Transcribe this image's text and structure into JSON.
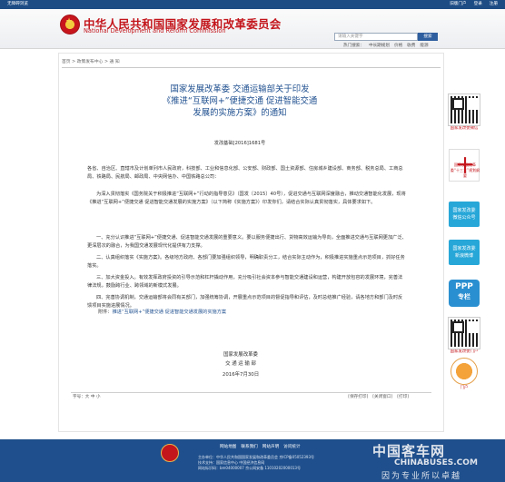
{
  "topbar": {
    "left": "无障碍浏览",
    "links": [
      "旧版门户",
      "登录",
      "注册"
    ]
  },
  "header": {
    "cn_title": "中华人民共和国国家发展和改革委员会",
    "en_title": "National Development and Reform Commission",
    "search_placeholder": "请输入关键字",
    "search_btn": "搜索",
    "quick_links": [
      "热门搜索：",
      "中长期规划",
      "价格",
      "收费",
      "能源"
    ]
  },
  "breadcrumb": "首页 > 政策发布中心 > 通  知",
  "article": {
    "title_lines": [
      "国家发展改革委  交通运输部关于印发",
      "《推进“互联网+”便捷交通  促进智能交通",
      "发展的实施方案》的通知"
    ],
    "doc_no": "发改基础[2016]1681号",
    "paragraphs": [
      "各省、自治区、直辖市及计划单列市人民政府，科技部、工业和信息化部、公安部、财政部、国土资源部、住房城乡建设部、商务部、税务总局、工商总局、铁路局、民航局、邮政局、中央网信办、中国铁路总公司：",
      "为深入贯彻落实《国务院关于积极推进“互联网+”行动的指导意见》（国发〔2015〕40号），促进交通与互联网深度融合，推动交通智能化发展，现将《推进“互联网+”便捷交通 促进智能交通发展的实施方案》（以下简称《实施方案》）印发你们，请结合实际认真贯彻落实，具体要求如下。",
      "一、充分认识推进“互联网+”便捷交通、促进智能交通发展的重要意义。要以服务便捷出行、货物高效运输为导向，全面推进交通与互联网更加广泛、更深层次的融合，为我国交通发展现代化提供有力支撑。",
      "二、认真组织落实《实施方案》。各级地方政府、各部门要加强组织领导，明确职责分工，结合实际主动作为，积极推进实施重点示范项目，抓好任务落实。",
      "三、加大资金投入。有效发挥政府投资的引导示范和杠杆撬动作用，充分吸引社会资本参与智能交通建设和运营，构建开放包容的发展环境，完善法律法规，鼓励跨行业、跨领域的新模式发展。",
      "四、完善协调机制，交通运输部将会同有关部门，加强统筹协调，开展重点示范项目的督促指导和评估，及时总结推广经验，请各地方和部门及时反馈项目实施进展情况。"
    ],
    "attach_prefix": "附件：",
    "attach_link": "推进“互联网+”便捷交通  促进智能交通发展的实施方案",
    "signature": [
      "国家发展改革委",
      "交 通 运 输 部",
      "2016年7月30日"
    ]
  },
  "tools": {
    "font_size": "字号：大 中 小",
    "links": [
      "[保存打印]",
      "[关闭窗口]",
      "[打印]"
    ]
  },
  "sidebar": {
    "qr1_label": "国家发改委微信",
    "img_label": "国家发展改革委“十三五”规划纲要",
    "btn1": [
      "国家发改委",
      "微信公众号"
    ],
    "btn2": [
      "国家发改委",
      "新浪微博"
    ],
    "ppp": [
      "PPP",
      "专栏"
    ],
    "qr2_label": "国家发改委门户",
    "app_label": "门户"
  },
  "footer": {
    "links": [
      "网站地图",
      "联系我们",
      "网站声明",
      "访问统计"
    ],
    "info": [
      "主办单位：中华人民共和国国家发展和改革委员会  京ICP备05052393号",
      "技术支持：国家信息中心  中国经济信息网",
      "网站标识码：bm04000007  京公网安备 11010202000013号"
    ],
    "wm_cn": "中国客车网",
    "wm_en": "CHINABUSES.COM",
    "wm_slogan": "因为专业所以卓越"
  }
}
